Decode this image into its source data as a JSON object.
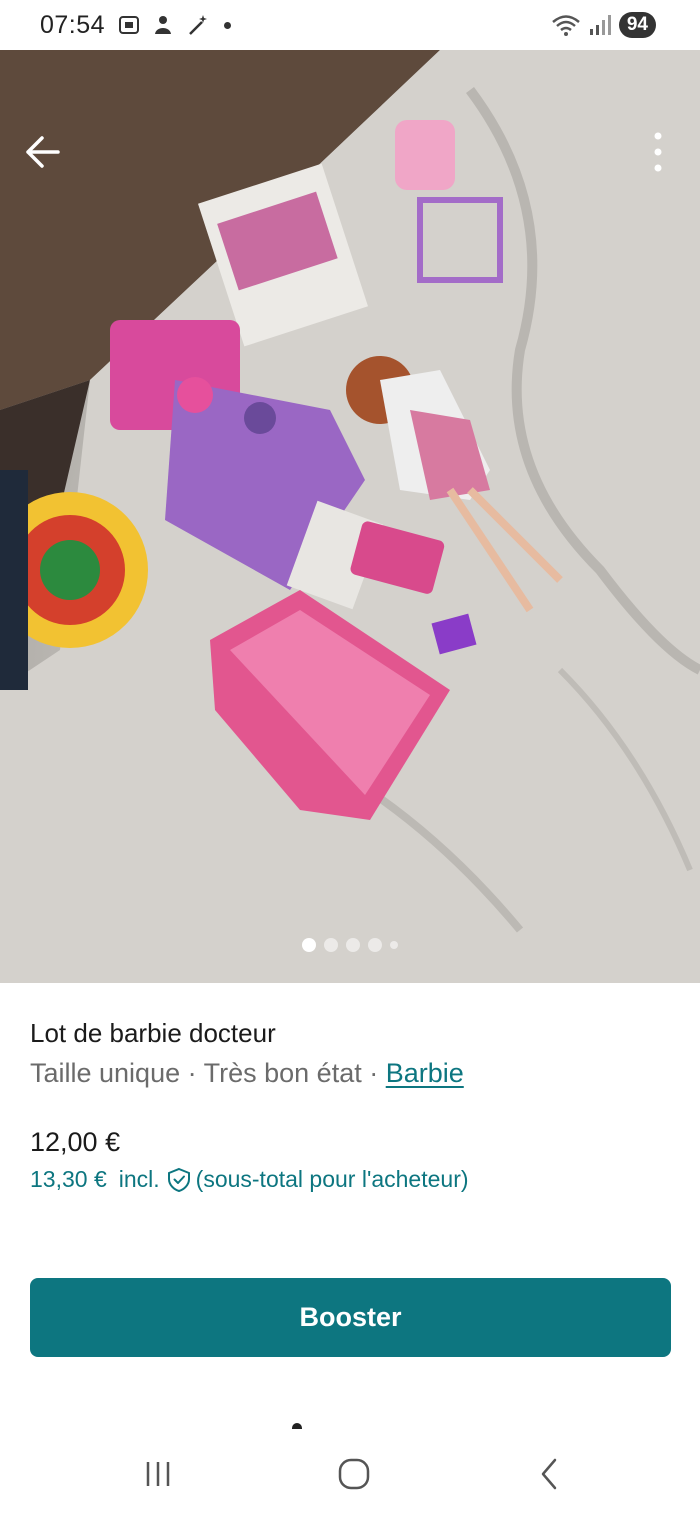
{
  "status_bar": {
    "time": "07:54",
    "battery": "94",
    "icons": [
      "screenshot-icon",
      "person-icon",
      "magic-wand-icon",
      "dot-icon",
      "wifi-icon",
      "signal-icon"
    ]
  },
  "photo": {
    "description_icons": [
      "back-arrow-icon",
      "more-vertical-icon"
    ],
    "dots_total": 5,
    "dots_active_index": 0
  },
  "listing": {
    "title": "Lot de barbie docteur",
    "size": "Taille unique",
    "separator": " · ",
    "condition": "Très bon état",
    "brand": "Barbie",
    "price": "12,00 €",
    "buyer_price": "13,30 €",
    "incl_label": "incl.",
    "buyer_note": "(sous-total pour l'acheteur)"
  },
  "actions": {
    "booster_label": "Booster"
  },
  "colors": {
    "accent": "#0d7680",
    "text_primary": "#1b1b1b",
    "text_secondary": "#6b6b6b"
  },
  "nav_bar": {
    "icons": [
      "recent-apps-icon",
      "home-icon",
      "back-icon"
    ]
  }
}
